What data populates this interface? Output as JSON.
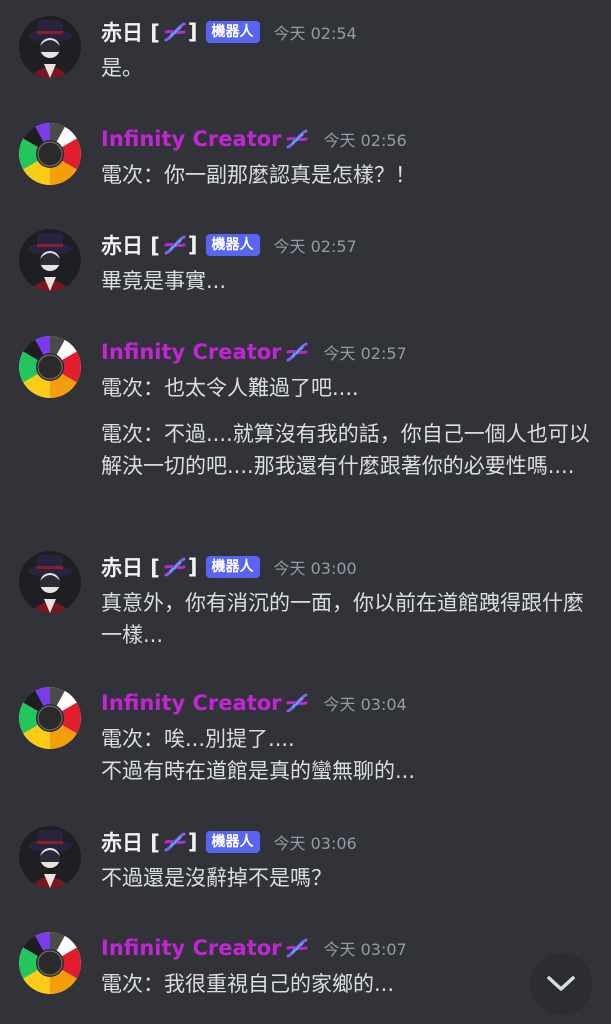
{
  "messages": [
    {
      "author": "赤日 [",
      "author_suffix": "]",
      "badge": "機器人",
      "time": "今天 02:54",
      "kind": "akahi",
      "lines": [
        "是。"
      ]
    },
    {
      "author": "Infinity Creator",
      "time": "今天 02:56",
      "kind": "infinity",
      "lines": [
        "電次：你一副那麼認真是怎樣？！"
      ]
    },
    {
      "author": "赤日 [",
      "author_suffix": "]",
      "badge": "機器人",
      "time": "今天 02:57",
      "kind": "akahi",
      "lines": [
        "畢竟是事實..."
      ]
    },
    {
      "author": "Infinity Creator",
      "time": "今天 02:57",
      "kind": "infinity",
      "lines": [
        "電次：也太令人難過了吧....",
        "電次：不過....就算沒有我的話，你自己一個人也可以解決一切的吧....那我還有什麼跟著你的必要性嗎...."
      ]
    },
    {
      "author": "赤日 [",
      "author_suffix": "]",
      "badge": "機器人",
      "time": "今天 03:00",
      "kind": "akahi",
      "lines": [
        "真意外，你有消沉的一面，你以前在道館跩得跟什麼一樣..."
      ]
    },
    {
      "author": "Infinity Creator",
      "time": "今天 03:04",
      "kind": "infinity",
      "lines": [
        "電次：唉...別提了....",
        "不過有時在道館是真的蠻無聊的..."
      ]
    },
    {
      "author": "赤日 [",
      "author_suffix": "]",
      "badge": "機器人",
      "time": "今天 03:06",
      "kind": "akahi",
      "lines": [
        "不過還是沒辭掉不是嗎？"
      ]
    },
    {
      "author": "Infinity Creator",
      "time": "今天 03:07",
      "kind": "infinity",
      "lines": [
        "電次：我很重視自己的家鄉的..."
      ]
    }
  ],
  "icons": {
    "author_emoji": "dna-icon",
    "scroll": "chevron-down-icon"
  },
  "colors": {
    "background": "#313338",
    "infinity_name": "#c026d3",
    "bot_badge": "#5865f2",
    "timestamp": "#949ba4",
    "message_text": "#dbdee1"
  }
}
